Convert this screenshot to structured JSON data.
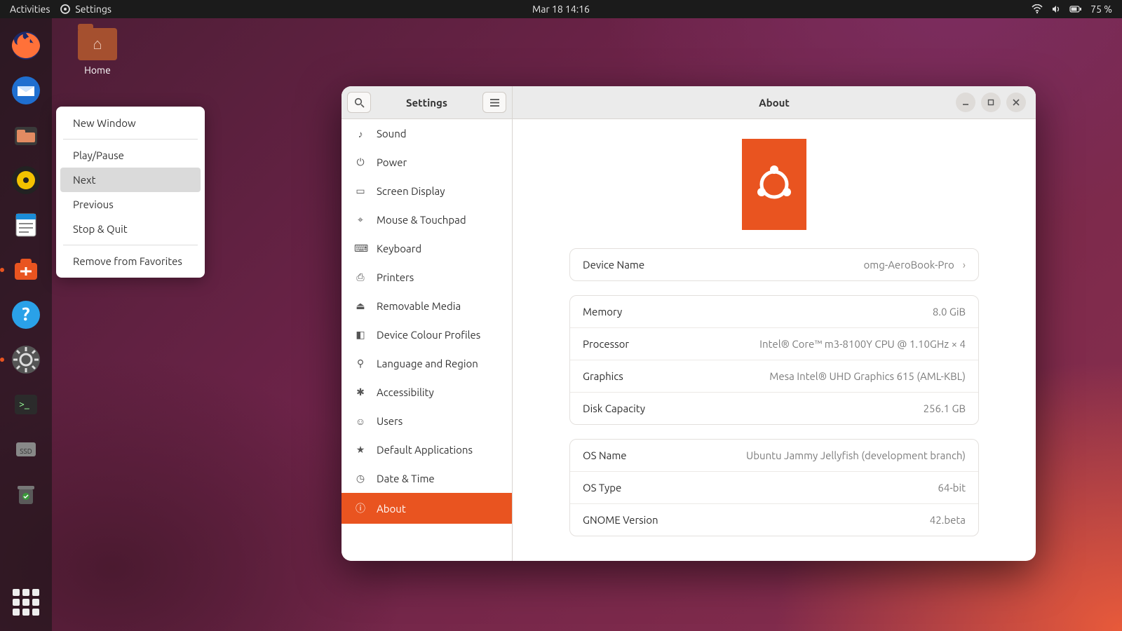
{
  "topbar": {
    "activities": "Activities",
    "app_indicator": "Settings",
    "clock": "Mar 18  14:16",
    "battery": "75 %"
  },
  "desktop": {
    "home_label": "Home"
  },
  "dock": {
    "items": [
      {
        "name": "firefox",
        "color": "#ff7139"
      },
      {
        "name": "thunderbird",
        "color": "#1f6fd0"
      },
      {
        "name": "files",
        "color": "#d9704a"
      },
      {
        "name": "rhythmbox",
        "color": "#f2c200"
      },
      {
        "name": "libreoffice-writer",
        "color": "#1a8cd8"
      },
      {
        "name": "ubuntu-software",
        "color": "#e95420"
      },
      {
        "name": "help",
        "color": "#2aa1e8"
      },
      {
        "name": "system-settings",
        "color": "#7a7a7a"
      },
      {
        "name": "terminal",
        "color": "#2b2b2b"
      },
      {
        "name": "drive",
        "color": "#6b6b6b"
      },
      {
        "name": "trash",
        "color": "#5a5a5a"
      }
    ],
    "running": [
      5,
      7
    ]
  },
  "context_menu": {
    "items": [
      "New Window",
      "Play/Pause",
      "Next",
      "Previous",
      "Stop & Quit",
      "Remove from Favorites"
    ],
    "separators_after": [
      0,
      4
    ],
    "highlight_index": 2
  },
  "settings": {
    "sidebar_title": "Settings",
    "content_title": "About",
    "categories": [
      {
        "icon": "♪",
        "label": "Sound"
      },
      {
        "icon": "⏻",
        "label": "Power"
      },
      {
        "icon": "▭",
        "label": "Screen Display"
      },
      {
        "icon": "⌖",
        "label": "Mouse & Touchpad"
      },
      {
        "icon": "⌨",
        "label": "Keyboard"
      },
      {
        "icon": "⎙",
        "label": "Printers"
      },
      {
        "icon": "⏏",
        "label": "Removable Media"
      },
      {
        "icon": "◧",
        "label": "Device Colour Profiles"
      },
      {
        "icon": "⚲",
        "label": "Language and Region"
      },
      {
        "icon": "✱",
        "label": "Accessibility"
      },
      {
        "icon": "☺",
        "label": "Users"
      },
      {
        "icon": "★",
        "label": "Default Applications"
      },
      {
        "icon": "◷",
        "label": "Date & Time"
      },
      {
        "icon": "ⓘ",
        "label": "About"
      }
    ],
    "selected_index": 13,
    "device_name": {
      "label": "Device Name",
      "value": "omg-AeroBook-Pro"
    },
    "hardware": [
      {
        "label": "Memory",
        "value": "8.0 GiB"
      },
      {
        "label": "Processor",
        "value": "Intel® Core™ m3-8100Y CPU @ 1.10GHz × 4"
      },
      {
        "label": "Graphics",
        "value": "Mesa Intel® UHD Graphics 615 (AML-KBL)"
      },
      {
        "label": "Disk Capacity",
        "value": "256.1 GB"
      }
    ],
    "software": [
      {
        "label": "OS Name",
        "value": "Ubuntu Jammy Jellyfish (development branch)"
      },
      {
        "label": "OS Type",
        "value": "64-bit"
      },
      {
        "label": "GNOME Version",
        "value": "42.beta"
      }
    ]
  }
}
